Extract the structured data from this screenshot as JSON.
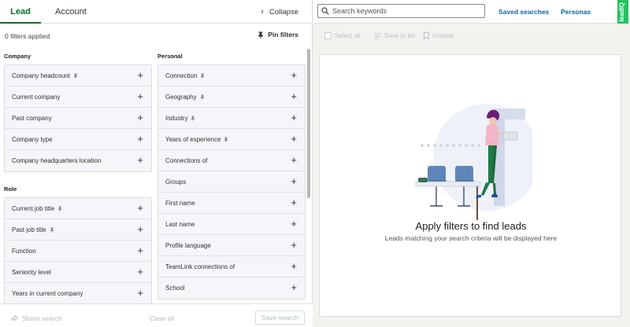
{
  "tabs": {
    "lead": "Lead",
    "account": "Account",
    "collapse": "Collapse"
  },
  "filters": {
    "count_text": "0 filters applied",
    "pin_label": "Pin filters"
  },
  "sections": {
    "company": {
      "title": "Company",
      "items": [
        {
          "label": "Company headcount",
          "pinned": true
        },
        {
          "label": "Current company",
          "pinned": false
        },
        {
          "label": "Past company",
          "pinned": false
        },
        {
          "label": "Company type",
          "pinned": false
        },
        {
          "label": "Company headquarters location",
          "pinned": false
        }
      ]
    },
    "role": {
      "title": "Role",
      "items": [
        {
          "label": "Current job title",
          "pinned": true
        },
        {
          "label": "Past job title",
          "pinned": true
        },
        {
          "label": "Function",
          "pinned": false
        },
        {
          "label": "Seniority level",
          "pinned": false
        },
        {
          "label": "Years in current company",
          "pinned": false
        }
      ]
    },
    "personal": {
      "title": "Personal",
      "items": [
        {
          "label": "Connection",
          "pinned": true
        },
        {
          "label": "Geography",
          "pinned": true
        },
        {
          "label": "Industry",
          "pinned": true
        },
        {
          "label": "Years of experience",
          "pinned": true
        },
        {
          "label": "Connections of",
          "pinned": false
        },
        {
          "label": "Groups",
          "pinned": false
        },
        {
          "label": "First name",
          "pinned": false
        },
        {
          "label": "Last name",
          "pinned": false
        },
        {
          "label": "Profile language",
          "pinned": false
        },
        {
          "label": "TeamLink connections of",
          "pinned": false
        },
        {
          "label": "School",
          "pinned": false
        }
      ]
    }
  },
  "bottom": {
    "share": "Share search",
    "clear": "Clear all",
    "save": "Save search"
  },
  "search": {
    "placeholder": "Search keywords"
  },
  "topnav": {
    "saved_searches": "Saved searches",
    "personas": "Personas",
    "badge": "leadIQ"
  },
  "actions": {
    "select_all": "Select all",
    "save_to_list": "Save to list",
    "unsave": "Unsave"
  },
  "empty_state": {
    "title": "Apply filters to find leads",
    "subtitle": "Leads matching your search criteria will be displayed here"
  },
  "colors": {
    "accent_green": "#0a6b2a",
    "link_blue": "#0a66a0",
    "badge_green": "#21c25e"
  }
}
